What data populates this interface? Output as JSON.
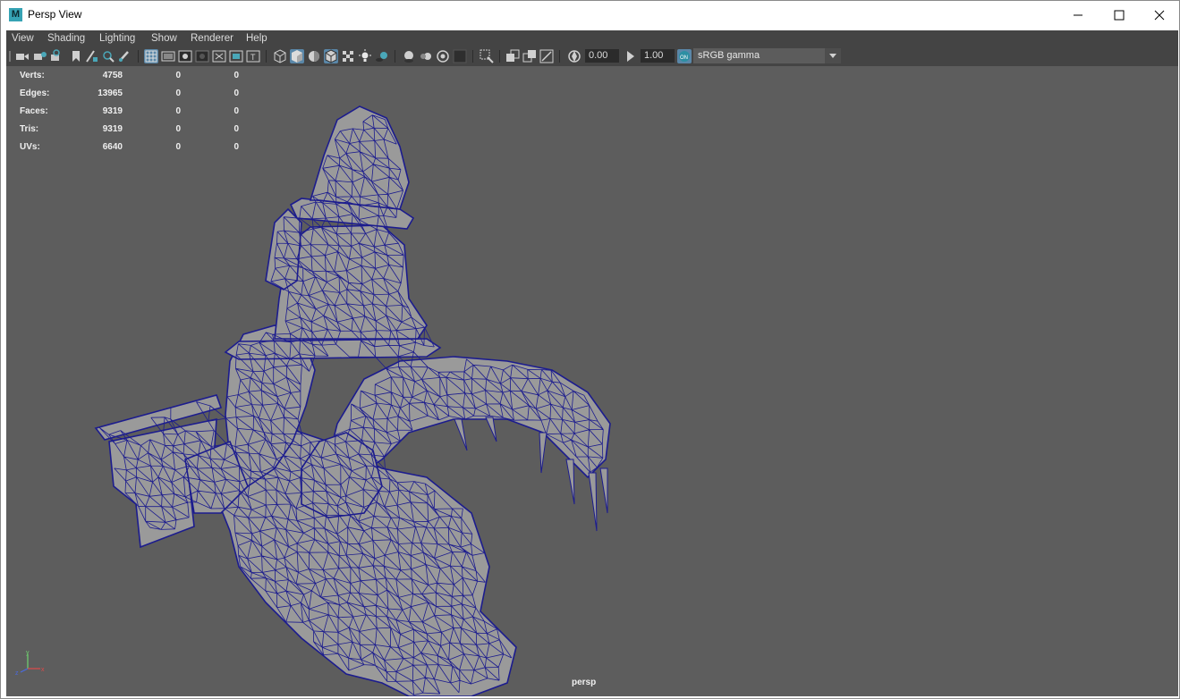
{
  "window": {
    "title": "Persp View",
    "app_icon_letter": "M"
  },
  "menubar": {
    "items": [
      "View",
      "Shading",
      "Lighting",
      "Show",
      "Renderer",
      "Help"
    ]
  },
  "toolbar": {
    "exposure_value": "0.00",
    "gamma_value": "1.00",
    "color_space": "sRGB gamma",
    "accent_color": "#5a87a8"
  },
  "hud": {
    "rows": [
      {
        "label": "Verts:",
        "total": "4758",
        "selected": "0",
        "component": "0"
      },
      {
        "label": "Edges:",
        "total": "13965",
        "selected": "0",
        "component": "0"
      },
      {
        "label": "Faces:",
        "total": "9319",
        "selected": "0",
        "component": "0"
      },
      {
        "label": "Tris:",
        "total": "9319",
        "selected": "0",
        "component": "0"
      },
      {
        "label": "UVs:",
        "total": "6640",
        "selected": "0",
        "component": "0"
      }
    ]
  },
  "viewport": {
    "camera_label": "persp",
    "background_color": "#5d5d5d",
    "mesh_fill_color": "#9a9a9a",
    "wireframe_color": "#1c1c8e",
    "axis_labels": [
      "y",
      "z",
      "x"
    ]
  }
}
